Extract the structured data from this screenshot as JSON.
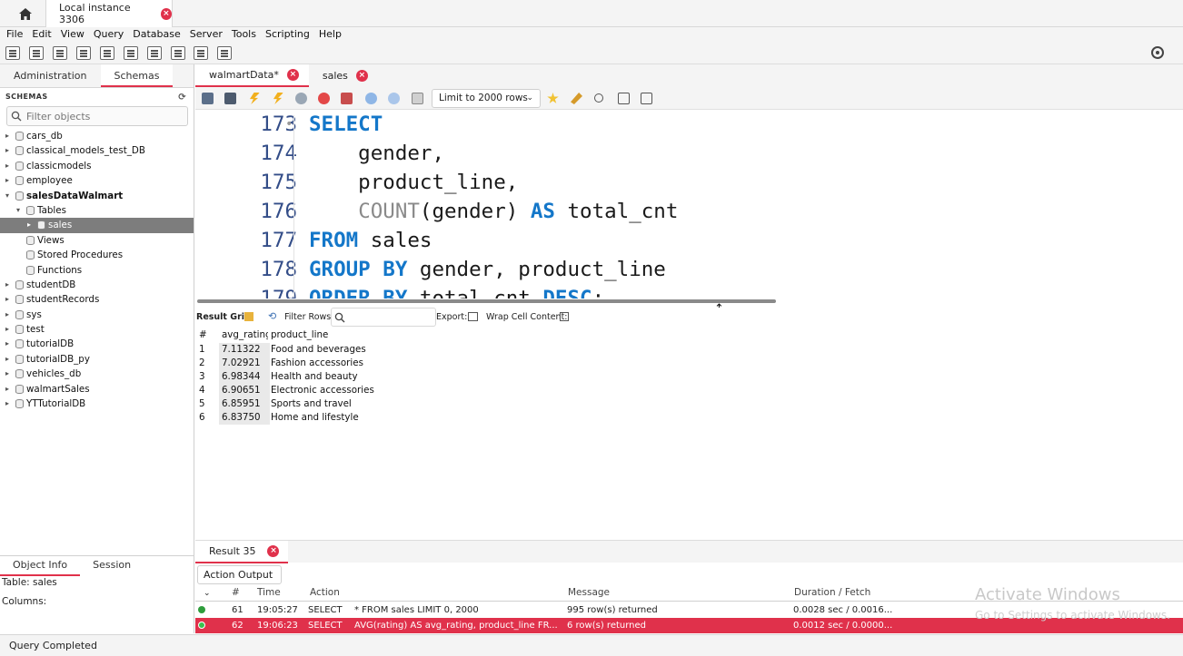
{
  "connection_tab": {
    "label": "Local instance 3306"
  },
  "menu": [
    "File",
    "Edit",
    "View",
    "Query",
    "Database",
    "Server",
    "Tools",
    "Scripting",
    "Help"
  ],
  "left_panel": {
    "tabs": [
      "Administration",
      "Schemas"
    ],
    "header": "SCHEMAS",
    "filter_placeholder": "Filter objects",
    "tree": [
      {
        "label": "cars_db",
        "level": 0,
        "expanded": false
      },
      {
        "label": "classical_models_test_DB",
        "level": 0,
        "expanded": false
      },
      {
        "label": "classicmodels",
        "level": 0,
        "expanded": false
      },
      {
        "label": "employee",
        "level": 0,
        "expanded": false
      },
      {
        "label": "salesDataWalmart",
        "level": 0,
        "expanded": true,
        "bold": true
      },
      {
        "label": "Tables",
        "level": 1,
        "expanded": true
      },
      {
        "label": "sales",
        "level": 2,
        "expanded": false,
        "selected": true
      },
      {
        "label": "Views",
        "level": 1
      },
      {
        "label": "Stored Procedures",
        "level": 1
      },
      {
        "label": "Functions",
        "level": 1
      },
      {
        "label": "studentDB",
        "level": 0,
        "expanded": false
      },
      {
        "label": "studentRecords",
        "level": 0,
        "expanded": false
      },
      {
        "label": "sys",
        "level": 0,
        "expanded": false
      },
      {
        "label": "test",
        "level": 0,
        "expanded": false
      },
      {
        "label": "tutorialDB",
        "level": 0,
        "expanded": false
      },
      {
        "label": "tutorialDB_py",
        "level": 0,
        "expanded": false
      },
      {
        "label": "vehicles_db",
        "level": 0,
        "expanded": false
      },
      {
        "label": "walmartSales",
        "level": 0,
        "expanded": false
      },
      {
        "label": "YTTutorialDB",
        "level": 0,
        "expanded": false
      }
    ]
  },
  "object_info": {
    "tabs": [
      "Object Info",
      "Session"
    ],
    "table_label": "Table: sales",
    "columns_label": "Columns:"
  },
  "editor_tabs": [
    {
      "label": "walmartData*",
      "active": true
    },
    {
      "label": "sales",
      "active": false
    }
  ],
  "limit_select": {
    "value": "Limit to 2000 rows"
  },
  "code_lines": [
    {
      "num": "173",
      "fold": "•",
      "tokens": [
        {
          "t": "SELECT",
          "k": "kw"
        }
      ]
    },
    {
      "num": "174",
      "tokens": [
        {
          "t": "    gender,"
        }
      ]
    },
    {
      "num": "175",
      "tokens": [
        {
          "t": "    product_line,"
        }
      ]
    },
    {
      "num": "176",
      "tokens": [
        {
          "t": "    "
        },
        {
          "t": "COUNT",
          "k": "fn"
        },
        {
          "t": "(gender) "
        },
        {
          "t": "AS",
          "k": "kw"
        },
        {
          "t": " total_cnt"
        }
      ]
    },
    {
      "num": "177",
      "tokens": [
        {
          "t": "FROM",
          "k": "kw"
        },
        {
          "t": " sales"
        }
      ]
    },
    {
      "num": "178",
      "tokens": [
        {
          "t": "GROUP BY",
          "k": "kw"
        },
        {
          "t": " gender, product_line"
        }
      ]
    },
    {
      "num": "179",
      "tokens": [
        {
          "t": "ORDER BY",
          "k": "kw"
        },
        {
          "t": " total_cnt "
        },
        {
          "t": "DESC",
          "k": "kw"
        },
        {
          "t": ";"
        }
      ]
    }
  ],
  "grid_toolbar": {
    "result_grid": "Result Grid",
    "filter_rows": "Filter Rows:",
    "export": "Export:",
    "wrap": "Wrap Cell Content:"
  },
  "result_grid": {
    "columns": [
      "#",
      "avg_rating",
      "product_line"
    ],
    "rows": [
      [
        "1",
        "7.11322",
        "Food and beverages"
      ],
      [
        "2",
        "7.02921",
        "Fashion accessories"
      ],
      [
        "3",
        "6.98344",
        "Health and beauty"
      ],
      [
        "4",
        "6.90651",
        "Electronic accessories"
      ],
      [
        "5",
        "6.85951",
        "Sports and travel"
      ],
      [
        "6",
        "6.83750",
        "Home and lifestyle"
      ]
    ]
  },
  "output": {
    "result_tab": "Result 35",
    "action_output": "Action Output",
    "columns": [
      "#",
      "Time",
      "Action",
      "Message",
      "Duration / Fetch"
    ],
    "rows": [
      {
        "num": "61",
        "time": "19:05:27",
        "action": "SELECT",
        "sql": "* FROM sales LIMIT 0, 2000",
        "message": "995 row(s) returned",
        "duration": "0.0028 sec / 0.0016...",
        "selected": false
      },
      {
        "num": "62",
        "time": "19:06:23",
        "action": "SELECT",
        "sql": "AVG(rating) AS avg_rating,   product_line FR...",
        "message": "6 row(s) returned",
        "duration": "0.0012 sec / 0.0000...",
        "selected": true
      }
    ]
  },
  "watermark": {
    "title": "Activate Windows",
    "subtitle": "Go to Settings to activate Windows."
  },
  "status": "Query Completed",
  "colors": {
    "accent": "#e0314b",
    "keyword": "#1477c9",
    "selection": "#7d7d7d"
  }
}
